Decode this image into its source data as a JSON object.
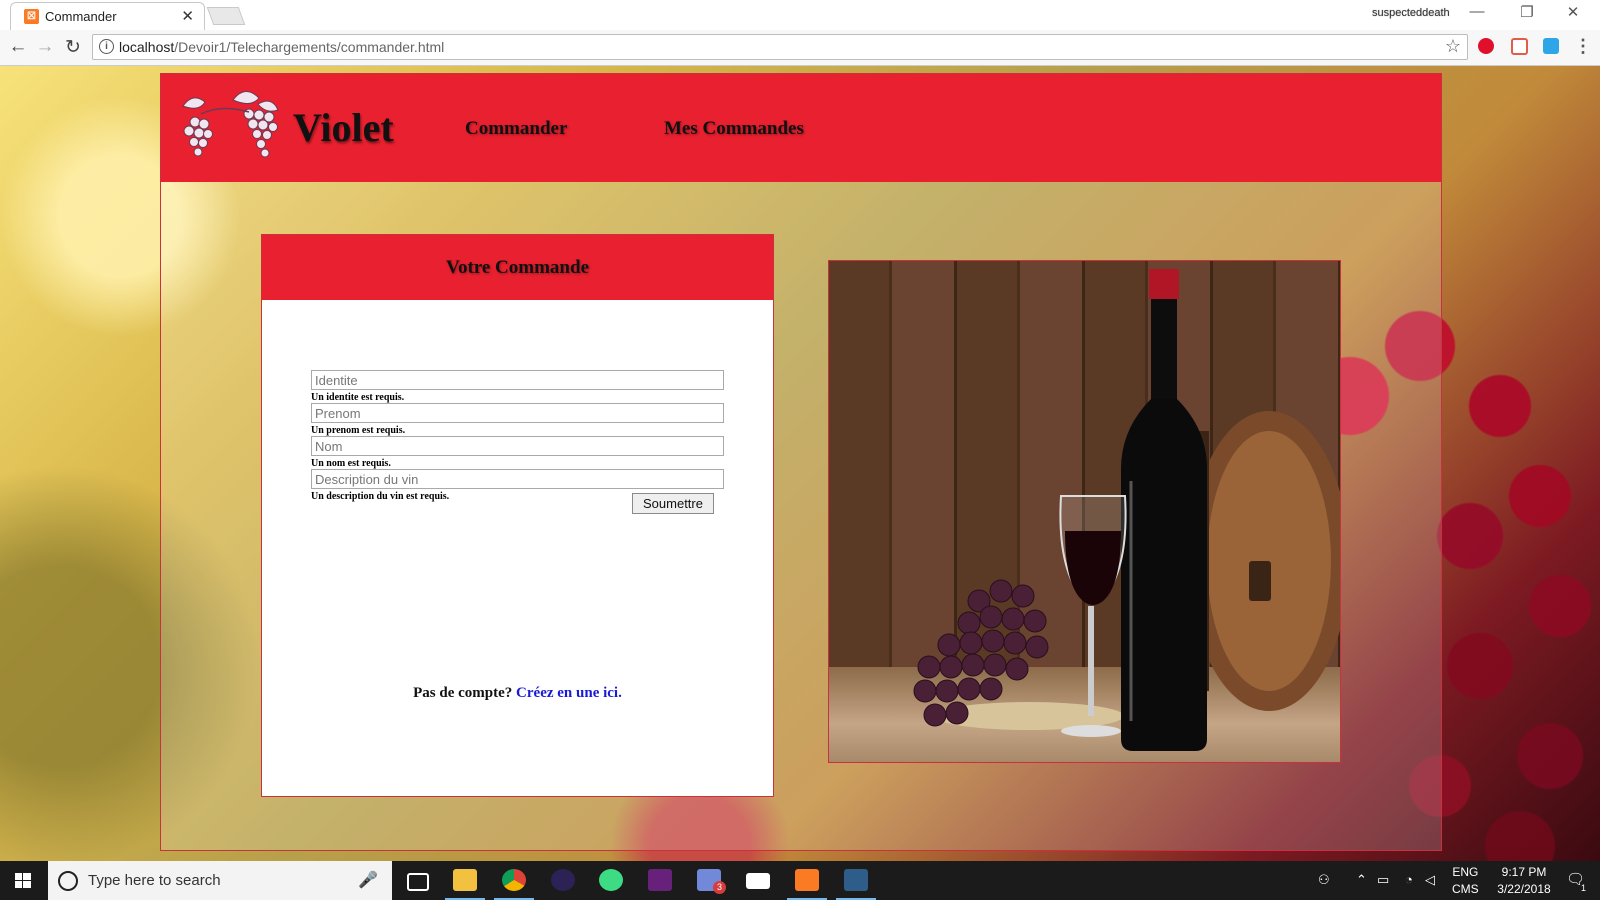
{
  "browser": {
    "tab_title": "Commander",
    "tab_close": "✕",
    "profile_name": "suspecteddeath",
    "url_host": "localhost",
    "url_path": "/Devoir1/Telechargements/commander.html"
  },
  "site": {
    "brand": "Violet",
    "nav": [
      "Commander",
      "Mes Commandes"
    ]
  },
  "form": {
    "title": "Votre Commande",
    "fields": [
      {
        "placeholder": "Identite",
        "value": "",
        "error": "Un identite est requis."
      },
      {
        "placeholder": "Prenom",
        "value": "",
        "error": "Un prenom est requis."
      },
      {
        "placeholder": "Nom",
        "value": "",
        "error": "Un nom est requis."
      },
      {
        "placeholder": "Description du vin",
        "value": "",
        "error": "Un description du vin est requis."
      }
    ],
    "submit_label": "Soumettre",
    "signup_prompt": "Pas de compte?",
    "signup_link": "Créez en une ici."
  },
  "taskbar": {
    "search_placeholder": "Type here to search",
    "lang_line1": "ENG",
    "lang_line2": "CMS",
    "time": "9:17 PM",
    "date": "3/22/2018",
    "notification_count": "1",
    "discord_badge": "3"
  },
  "colors": {
    "header_red": "#e8202f",
    "link_blue": "#1a1ad6"
  }
}
